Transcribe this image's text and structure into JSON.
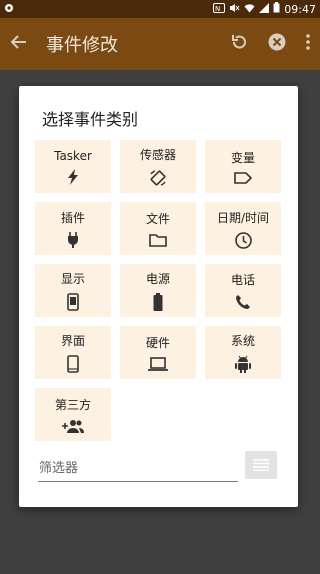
{
  "statusbar": {
    "time": "09:47"
  },
  "appbar": {
    "title": "事件修改"
  },
  "dialog": {
    "title": "选择事件类别",
    "categories": [
      {
        "label": "Tasker",
        "icon": "bolt-icon"
      },
      {
        "label": "传感器",
        "icon": "screen-rotation-icon"
      },
      {
        "label": "变量",
        "icon": "label-icon"
      },
      {
        "label": "插件",
        "icon": "plug-icon"
      },
      {
        "label": "文件",
        "icon": "folder-icon"
      },
      {
        "label": "日期/时间",
        "icon": "clock-icon"
      },
      {
        "label": "显示",
        "icon": "phone-screen-icon"
      },
      {
        "label": "电源",
        "icon": "battery-icon"
      },
      {
        "label": "电话",
        "icon": "phone-call-icon"
      },
      {
        "label": "界面",
        "icon": "smartphone-icon"
      },
      {
        "label": "硬件",
        "icon": "laptop-icon"
      },
      {
        "label": "系统",
        "icon": "android-icon"
      },
      {
        "label": "第三方",
        "icon": "group-add-icon"
      }
    ],
    "filter": {
      "placeholder": "筛选器"
    }
  },
  "colors": {
    "appbar": "#7a4a12",
    "statusbar": "#4a2a0a",
    "tile_bg": "#fdf1e2",
    "dim": "#3f3f3f"
  }
}
